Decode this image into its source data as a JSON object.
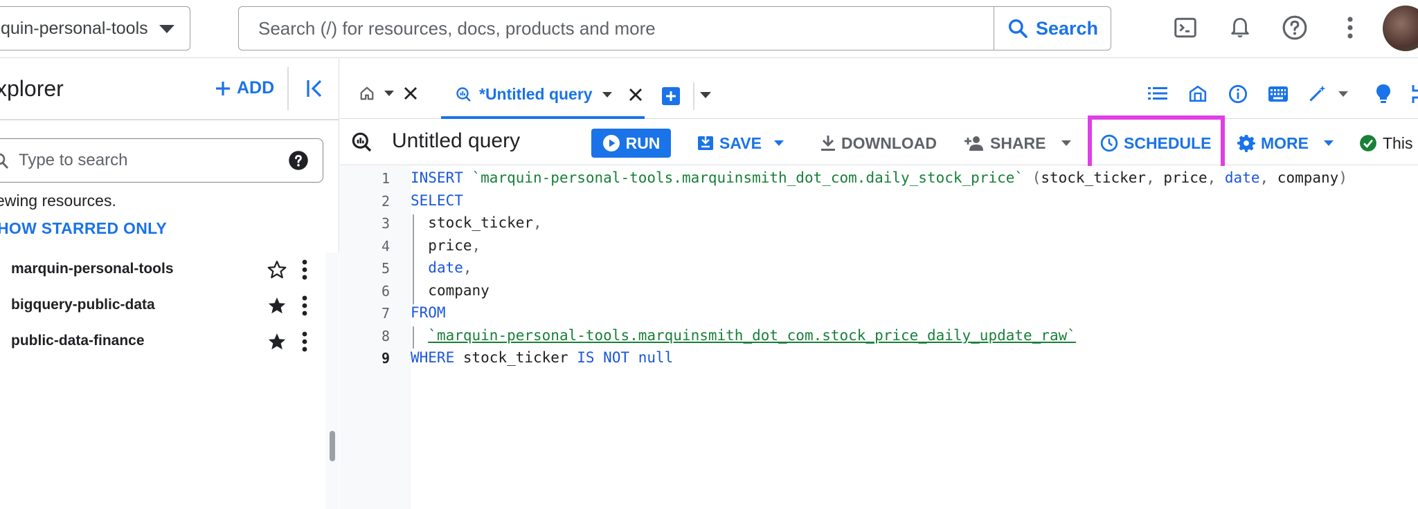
{
  "topbar": {
    "project": "quin-personal-tools",
    "search_placeholder": "Search (/) for resources, docs, products and more",
    "search_button": "Search",
    "icons": [
      "terminal-icon",
      "bell-icon",
      "help-icon",
      "more-vert-icon",
      "avatar"
    ]
  },
  "sidebar": {
    "title": "xplorer",
    "add_label": "ADD",
    "filter_placeholder": "Type to search",
    "viewing_text": "ewing resources.",
    "show_starred": "HOW STARRED ONLY",
    "items": [
      {
        "label": "marquin-personal-tools",
        "starred": false
      },
      {
        "label": "bigquery-public-data",
        "starred": true
      },
      {
        "label": "public-data-finance",
        "starred": true
      }
    ]
  },
  "tabs": {
    "query_tab_label": "*Untitled query"
  },
  "toolbar": {
    "title": "Untitled query",
    "run": "RUN",
    "save": "SAVE",
    "download": "DOWNLOAD",
    "share": "SHARE",
    "schedule": "SCHEDULE",
    "more": "MORE",
    "status": "This"
  },
  "editor": {
    "line_numbers": [
      "1",
      "2",
      "3",
      "4",
      "5",
      "6",
      "7",
      "8",
      "9"
    ],
    "lines": [
      {
        "k1": "INSERT",
        "s1": "`marquin-personal-tools.marquinsmith_dot_com.daily_stock_price`",
        "p1": "(",
        "t1": "stock_ticker",
        "c1": ",",
        "t2": "price",
        "c2": ",",
        "k2": "date",
        "c3": ",",
        "t3": "company",
        "p2": ")"
      },
      {
        "k1": "SELECT"
      },
      {
        "t1": "stock_ticker",
        "c1": ","
      },
      {
        "t1": "price",
        "c1": ","
      },
      {
        "k1": "date",
        "c1": ","
      },
      {
        "t1": "company"
      },
      {
        "k1": "FROM"
      },
      {
        "s1": "`marquin-personal-tools.marquinsmith_dot_com.stock_price_daily_update_raw`"
      },
      {
        "k1": "WHERE",
        "t1": "stock_ticker",
        "k2": "IS NOT null"
      }
    ]
  },
  "colors": {
    "accent": "#1a73e8",
    "highlight": "#e03ee8",
    "string": "#188038",
    "success": "#188038"
  }
}
